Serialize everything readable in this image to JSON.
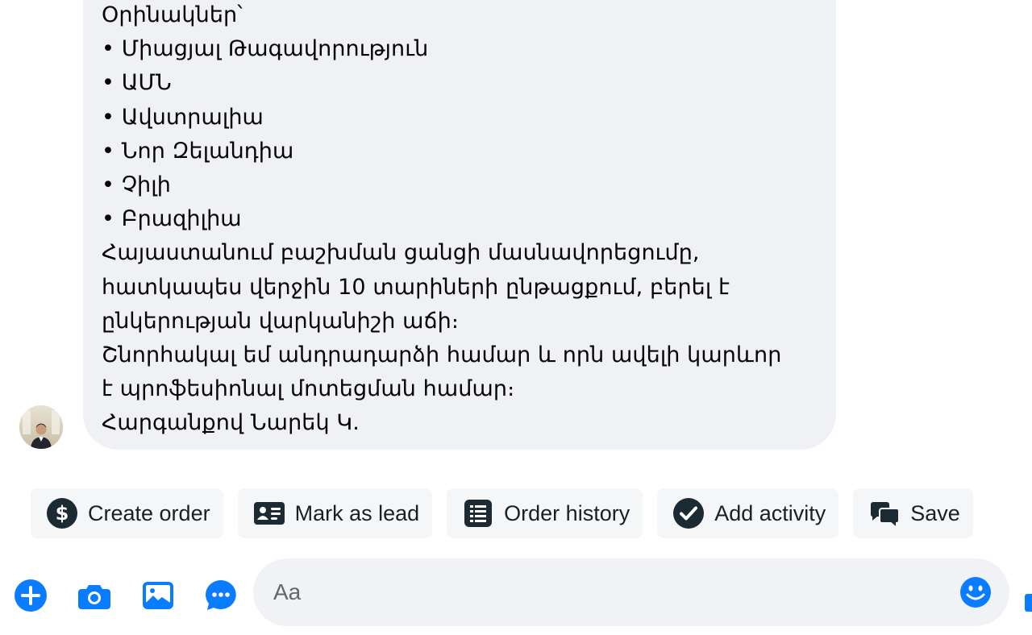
{
  "message": {
    "lines": [
      "Օրինակներ՝",
      "• Միացյալ Թագավորություն",
      "• ԱՄՆ",
      "• Ավստրալիա",
      "• Նոր Զելանդիա",
      "• Չիլի",
      "• Բրազիլիա",
      "Հայաստանում բաշխման ցանցի մասնավորեցումը,",
      "հատկապես վերջին 10 տարիների ընթացքում, բերել է",
      "ընկերության վարկանիշի աճի։",
      "Շնորհակալ եմ անդրադարձի համար և որն ավելի կարևոր",
      "է պրոֆեսիոնալ մոտեցման համար։",
      "Հարգանքով Նարեկ Կ."
    ]
  },
  "actions": [
    {
      "label": "Create order",
      "icon": "dollar-circle-icon"
    },
    {
      "label": "Mark as lead",
      "icon": "contact-card-icon"
    },
    {
      "label": "Order history",
      "icon": "receipt-list-icon"
    },
    {
      "label": "Add activity",
      "icon": "checkmark-circle-icon"
    },
    {
      "label": "Save",
      "icon": "chat-bubbles-icon"
    }
  ],
  "composer": {
    "placeholder": "Aa",
    "icons": [
      "plus-icon",
      "camera-icon",
      "image-icon",
      "chat-options-icon",
      "emoji-icon"
    ]
  },
  "colors": {
    "accent": "#0a7cff",
    "bubble": "#f0f1f5",
    "chip_icon": "#1c2b33",
    "input_bg": "#f0f2f5"
  }
}
